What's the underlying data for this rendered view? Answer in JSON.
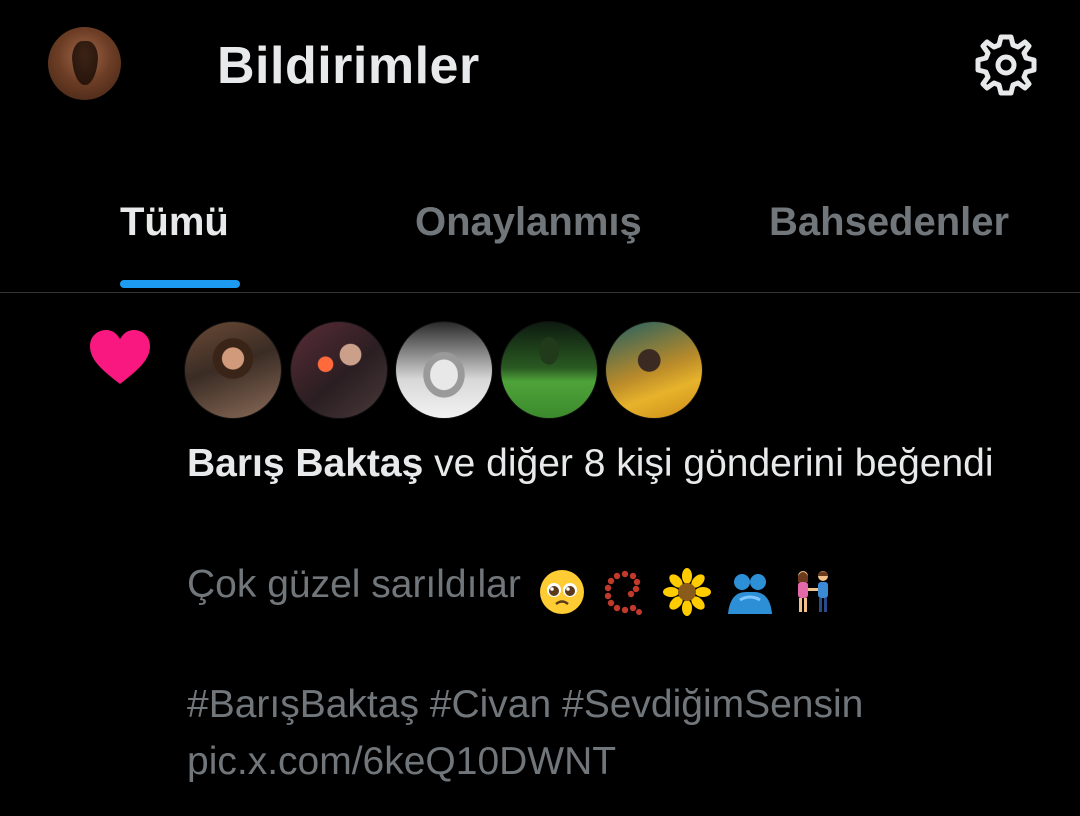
{
  "header": {
    "title": "Bildirimler",
    "avatar_icon": "profile-avatar",
    "settings_icon": "gear-icon"
  },
  "tabs": [
    {
      "label": "Tümü",
      "active": true
    },
    {
      "label": "Onaylanmış",
      "active": false
    },
    {
      "label": "Bahsedenler",
      "active": false
    }
  ],
  "notification": {
    "type_icon": "heart-icon",
    "actor": "Barış Baktaş",
    "action_text": " ve diğer 8 kişi gönderini beğendi",
    "tweet_text": "Çok güzel sarıldılar",
    "tweet_emojis": [
      "pleading-face-emoji",
      "prayer-beads-emoji",
      "sunflower-emoji",
      "people-hugging-emoji",
      "couple-emoji"
    ],
    "tweet_hashtags": "#BarışBaktaş #Civan #SevdiğimSensin",
    "tweet_link": "pic.x.com/6keQ10DWNT",
    "avatar_count": 5
  },
  "colors": {
    "background": "#000000",
    "text_primary": "#e7e9ea",
    "text_secondary": "#71767b",
    "accent": "#1d9bf0",
    "like": "#f91880"
  }
}
